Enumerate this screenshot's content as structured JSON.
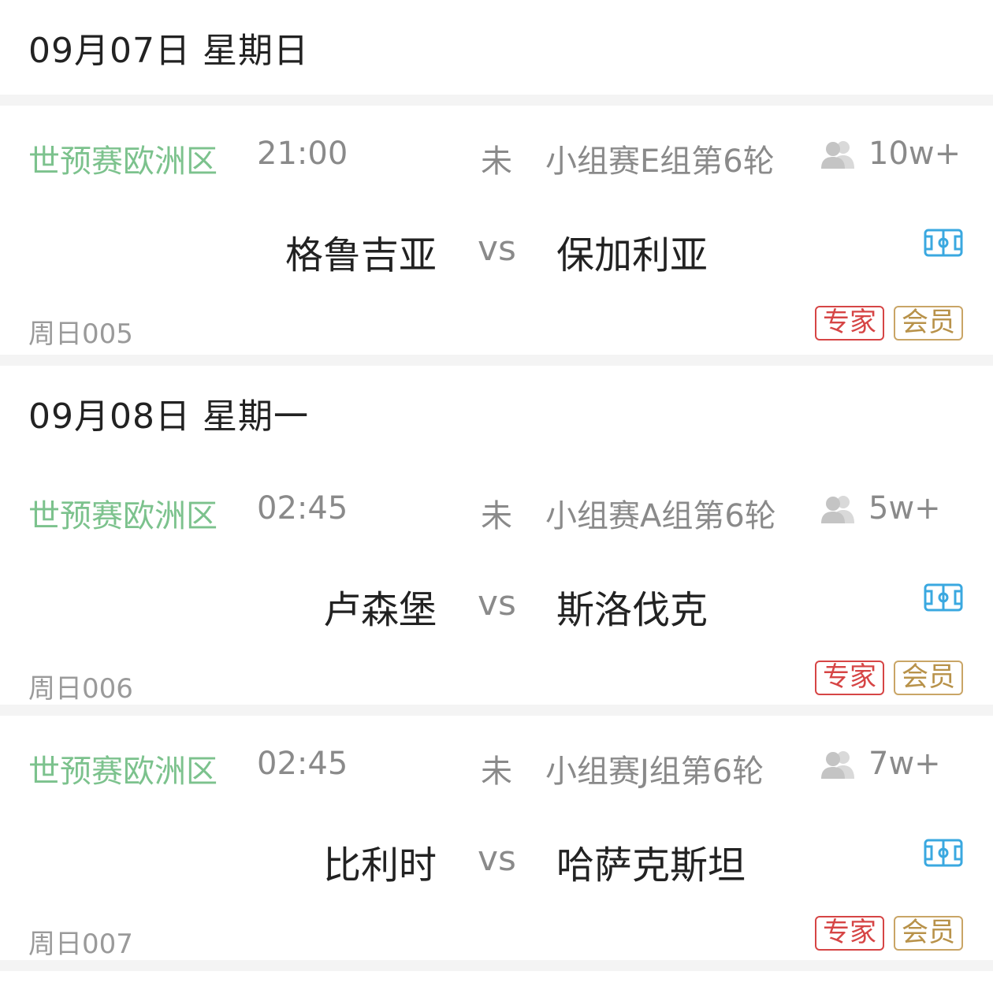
{
  "days": [
    {
      "date_label": "09月07日 星期日",
      "matches": [
        {
          "league": "世预赛欧洲区",
          "time": "21:00",
          "status": "未",
          "round": "小组赛E组第6轮",
          "heat": "10w+",
          "home": "格鲁吉亚",
          "vs": "vs",
          "away": "保加利亚",
          "code": "周日005",
          "tag_expert": "专家",
          "tag_member": "会员"
        }
      ]
    },
    {
      "date_label": "09月08日 星期一",
      "matches": [
        {
          "league": "世预赛欧洲区",
          "time": "02:45",
          "status": "未",
          "round": "小组赛A组第6轮",
          "heat": "5w+",
          "home": "卢森堡",
          "vs": "vs",
          "away": "斯洛伐克",
          "code": "周日006",
          "tag_expert": "专家",
          "tag_member": "会员"
        },
        {
          "league": "世预赛欧洲区",
          "time": "02:45",
          "status": "未",
          "round": "小组赛J组第6轮",
          "heat": "7w+",
          "home": "比利时",
          "vs": "vs",
          "away": "哈萨克斯坦",
          "code": "周日007",
          "tag_expert": "专家",
          "tag_member": "会员"
        }
      ]
    }
  ],
  "colors": {
    "league": "#7cc28d",
    "expert": "#d64545",
    "member": "#b8924a",
    "field_icon": "#3aa8e0"
  },
  "icons": {
    "heat": "people-icon",
    "detail": "football-field-icon"
  }
}
